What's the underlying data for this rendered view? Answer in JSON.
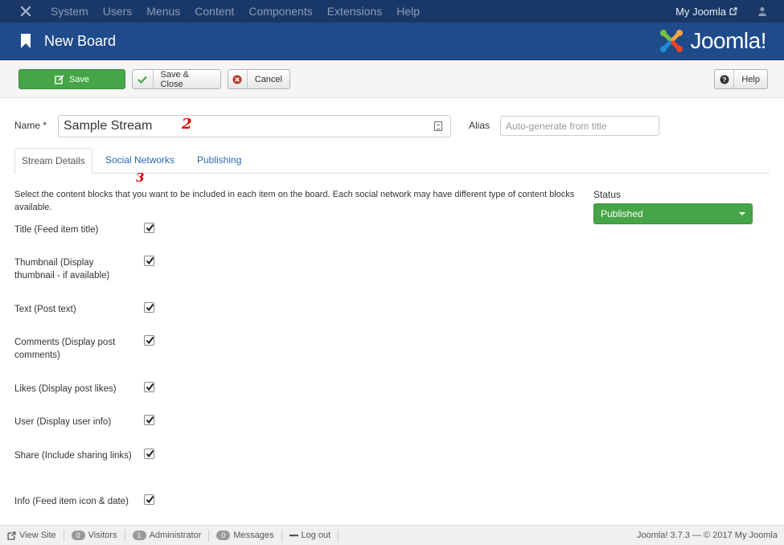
{
  "topnav": {
    "menu": [
      "System",
      "Users",
      "Menus",
      "Content",
      "Components",
      "Extensions",
      "Help"
    ],
    "site_link": "My Joomla"
  },
  "header": {
    "title": "New Board",
    "brand": "Joomla!"
  },
  "toolbar": {
    "save_label": "Save",
    "save_close_label": "Save & Close",
    "cancel_label": "Cancel",
    "help_label": "Help"
  },
  "form": {
    "name_label": "Name *",
    "name_value": "Sample Stream",
    "alias_label": "Alias",
    "alias_placeholder": "Auto-generate from title"
  },
  "annotations": {
    "a2": "2",
    "a3": "3"
  },
  "tabs": [
    {
      "label": "Stream Details",
      "active": true
    },
    {
      "label": "Social Networks",
      "active": false
    },
    {
      "label": "Publishing",
      "active": false
    }
  ],
  "details": {
    "description": "Select the content blocks that you want to be included in each item on the board. Each social network may have different type of content blocks available.",
    "status_label": "Status",
    "status_value": "Published",
    "options": [
      {
        "label": "Title (Feed item title)",
        "checked": true
      },
      {
        "label": "Thumbnail (Display thumbnail - if available)",
        "checked": true
      },
      {
        "label": "Text (Post text)",
        "checked": true
      },
      {
        "label": "Comments (Display post comments)",
        "checked": true
      },
      {
        "label": "Likes (Display post likes)",
        "checked": true
      },
      {
        "label": "User (Display user info)",
        "checked": true
      },
      {
        "label": "Share (Include sharing links)",
        "checked": true
      },
      {
        "label": "Info (Feed item icon & date)",
        "checked": true
      }
    ]
  },
  "footer": {
    "view_site": "View Site",
    "visitors_count": "0",
    "visitors_label": "Visitors",
    "admin_count": "1",
    "admin_label": "Administrator",
    "messages_count": "0",
    "messages_label": "Messages",
    "logout": "Log out",
    "copyright": "Joomla! 3.7.3 — © 2017 My Joomla"
  },
  "colors": {
    "nav": "#1a3867",
    "header": "#1f4b8a",
    "success": "#46a546",
    "link": "#2a69b8"
  }
}
